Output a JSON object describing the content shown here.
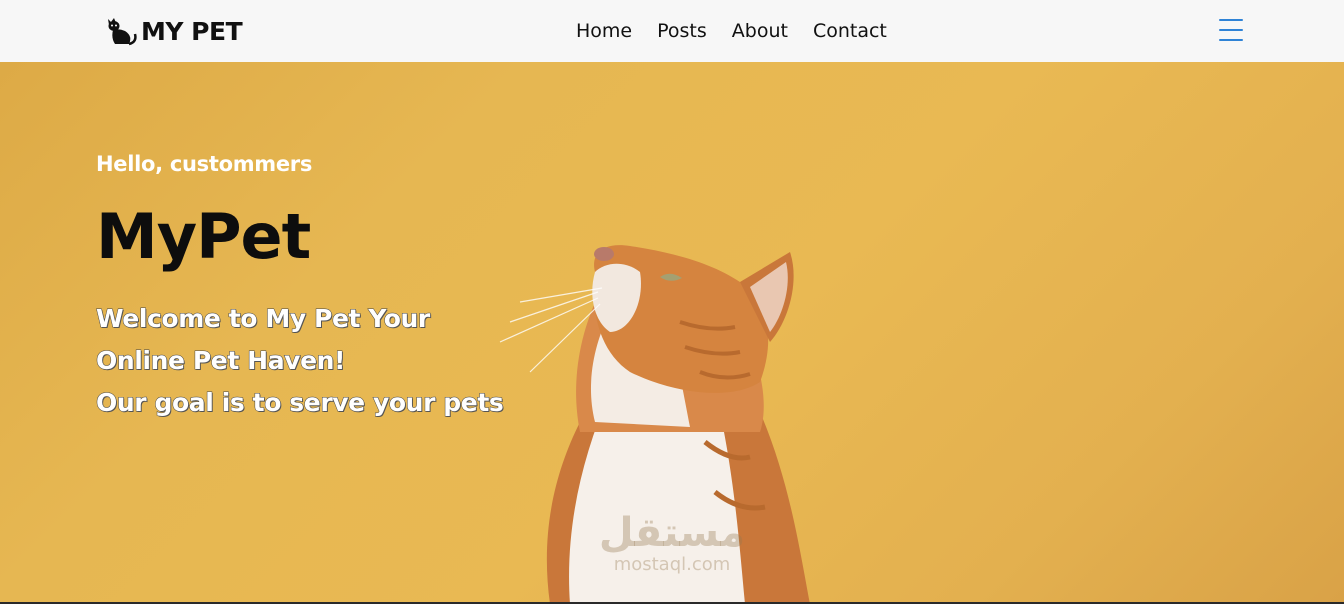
{
  "brand": {
    "name": "MY PET",
    "icon": "cat-icon"
  },
  "nav": {
    "links": [
      {
        "label": "Home"
      },
      {
        "label": "Posts"
      },
      {
        "label": "About"
      },
      {
        "label": "Contact"
      }
    ],
    "menu_icon": "hamburger-menu-icon"
  },
  "hero": {
    "greeting": "Hello, custommers",
    "title": "MyPet",
    "tagline_lines": [
      "Welcome to My Pet Your",
      "Online Pet Haven!",
      "Our goal is to serve your pets"
    ],
    "background_color": "#e9b953",
    "image": "orange-white-cat-looking-up"
  },
  "watermark": {
    "main": "مستقل",
    "sub": "mostaql.com"
  },
  "colors": {
    "accent": "#2f83d6",
    "nav_bg": "#f7f7f7",
    "text_dark": "#111111"
  }
}
